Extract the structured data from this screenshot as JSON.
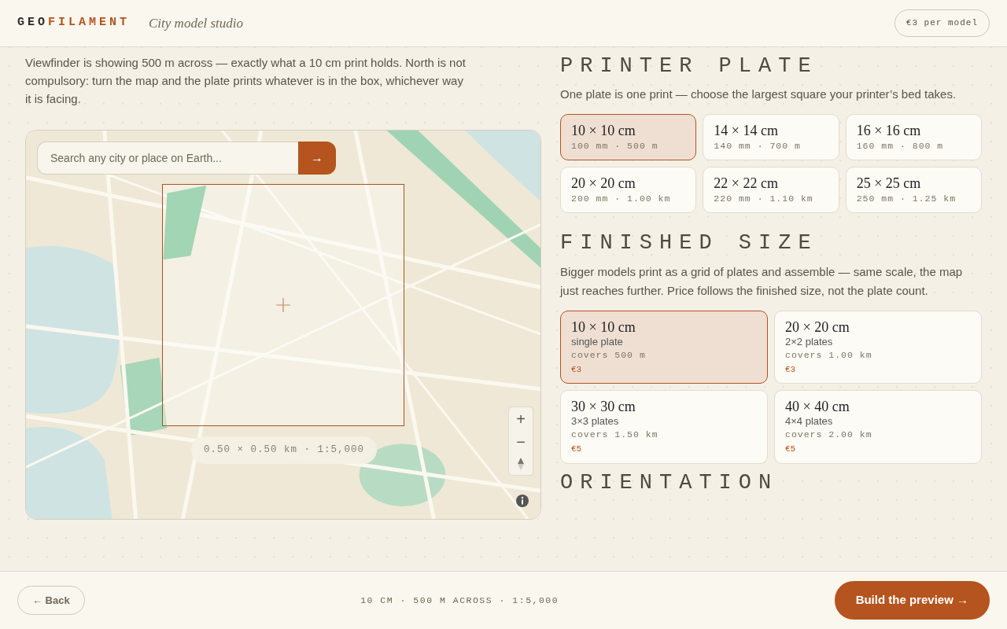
{
  "header": {
    "brand": [
      {
        "text": "GEO",
        "accent": false
      },
      {
        "text": "FILAMENT",
        "accent": true
      }
    ],
    "tagline": "City model studio",
    "price_badge": "€3 per model"
  },
  "intro": "Viewfinder is showing 500 m across — exactly what a 10 cm print holds. North is not compulsory: turn the map and the plate prints whatever is in the box, whichever way it is facing.",
  "map": {
    "search": {
      "placeholder": "Search any city or place on Earth..."
    },
    "go_button": "→",
    "zoom_in": "+",
    "zoom_out": "−",
    "readout": "0.50 × 0.50 km · 1:5,000"
  },
  "printer_plate": {
    "title": "PRINTER PLATE",
    "description": "One plate is one print — choose the largest square your printer’s bed takes.",
    "options": [
      {
        "size": "10 × 10 cm",
        "detail": "100 mm · 500 m",
        "selected": true
      },
      {
        "size": "14 × 14 cm",
        "detail": "140 mm · 700 m",
        "selected": false
      },
      {
        "size": "16 × 16 cm",
        "detail": "160 mm · 800 m",
        "selected": false
      },
      {
        "size": "20 × 20 cm",
        "detail": "200 mm · 1.00 km",
        "selected": false
      },
      {
        "size": "22 × 22 cm",
        "detail": "220 mm · 1.10 km",
        "selected": false
      },
      {
        "size": "25 × 25 cm",
        "detail": "250 mm · 1.25 km",
        "selected": false
      }
    ]
  },
  "finished_size": {
    "title": "FINISHED SIZE",
    "description": "Bigger models print as a grid of plates and assemble — same scale, the map just reaches further. Price follows the finished size, not the plate count.",
    "options": [
      {
        "size": "10 × 10 cm",
        "plates": "single plate",
        "covers": "covers 500 m",
        "price": "€3",
        "selected": true
      },
      {
        "size": "20 × 20 cm",
        "plates": "2×2 plates",
        "covers": "covers 1.00 km",
        "price": "€3",
        "selected": false
      },
      {
        "size": "30 × 30 cm",
        "plates": "3×3 plates",
        "covers": "covers 1.50 km",
        "price": "€5",
        "selected": false
      },
      {
        "size": "40 × 40 cm",
        "plates": "4×4 plates",
        "covers": "covers 2.00 km",
        "price": "€5",
        "selected": false
      }
    ]
  },
  "orientation": {
    "title": "ORIENTATION"
  },
  "footer": {
    "back": "← Back",
    "summary": "10 CM · 500 M ACROSS · 1:5,000",
    "build": "Build the preview →"
  }
}
